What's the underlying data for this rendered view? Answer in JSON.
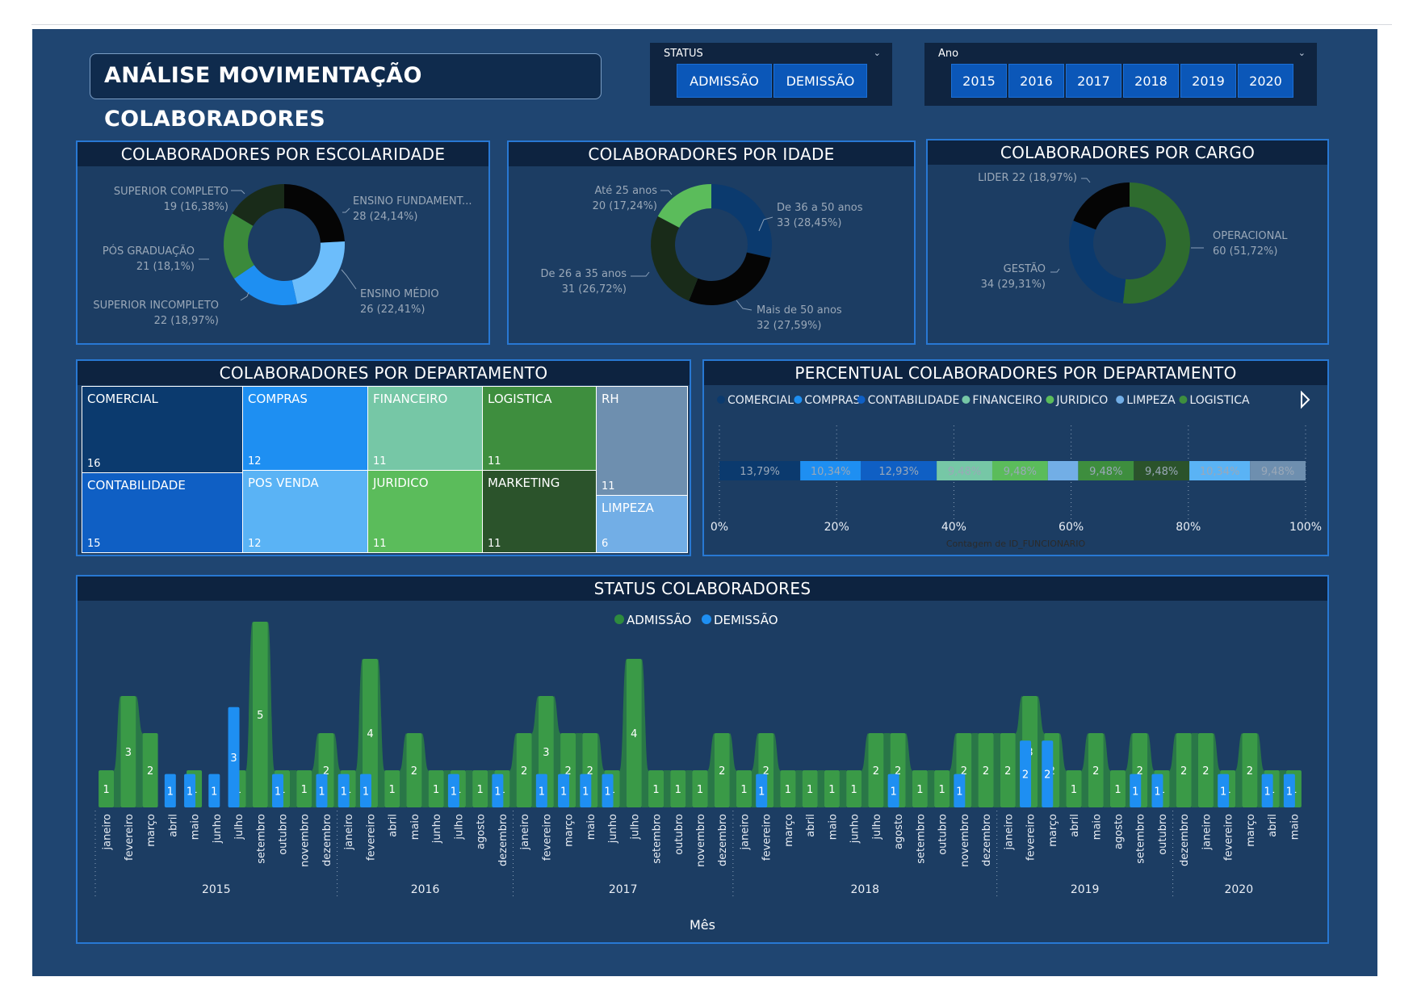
{
  "header": {
    "title": "ANÁLISE MOVIMENTAÇÃO COLABORADORES"
  },
  "status_slicer": {
    "label": "STATUS",
    "options": [
      "ADMISSÃO",
      "DEMISSÃO"
    ]
  },
  "year_slicer": {
    "label": "Ano",
    "options": [
      "2015",
      "2016",
      "2017",
      "2018",
      "2019",
      "2020"
    ]
  },
  "colors": {
    "dark_navy": "#0b3a6e",
    "blue": "#1e8ff2",
    "light_blue": "#6cbdfb",
    "green_dark": "#2e6b2e",
    "green": "#44a844",
    "green_light": "#5bbc5b",
    "black": "#050505",
    "very_dark_green": "#192b19"
  },
  "donut_escolaridade": {
    "title": "COLABORADORES POR ESCOLARIDADE",
    "slices": [
      {
        "label": "ENSINO FUNDAMENT...",
        "value": 28,
        "display": "28 (24,14%)",
        "color": "#050505"
      },
      {
        "label": "ENSINO MÉDIO",
        "value": 26,
        "display": "26 (22,41%)",
        "color": "#6cbdfb"
      },
      {
        "label": "SUPERIOR INCOMPLETO",
        "value": 22,
        "display": "22 (18,97%)",
        "color": "#1e8ff2"
      },
      {
        "label": "PÓS GRADUAÇÃO",
        "value": 21,
        "display": "21 (18,1%)",
        "color": "#3b8a3b"
      },
      {
        "label": "SUPERIOR COMPLETO",
        "value": 19,
        "display": "19 (16,38%)",
        "color": "#192b19"
      }
    ]
  },
  "donut_idade": {
    "title": "COLABORADORES POR IDADE",
    "slices": [
      {
        "label": "De 36 a 50 anos",
        "value": 33,
        "display": "33 (28,45%)",
        "color": "#0b3a6e"
      },
      {
        "label": "Mais de 50 anos",
        "value": 32,
        "display": "32 (27,59%)",
        "color": "#050505"
      },
      {
        "label": "De 26 a 35 anos",
        "value": 31,
        "display": "31 (26,72%)",
        "color": "#192b19"
      },
      {
        "label": "Até 25 anos",
        "value": 20,
        "display": "20 (17,24%)",
        "color": "#5bbc5b"
      }
    ]
  },
  "donut_cargo": {
    "title": "COLABORADORES POR CARGO",
    "slices": [
      {
        "label": "OPERACIONAL",
        "value": 60,
        "display": "60 (51,72%)",
        "color": "#2e6b2e"
      },
      {
        "label": "GESTÃO",
        "value": 34,
        "display": "34 (29,31%)",
        "color": "#0b3a6e"
      },
      {
        "label": "LIDER",
        "value": 22,
        "display": "LIDER 22 (18,97%)",
        "color": "#050505"
      }
    ]
  },
  "treemap": {
    "title": "COLABORADORES POR DEPARTAMENTO",
    "cells": [
      {
        "name": "COMERCIAL",
        "value": "16",
        "color": "#0b3a6e"
      },
      {
        "name": "CONTABILIDADE",
        "value": "15",
        "color": "#0f5fc4"
      },
      {
        "name": "COMPRAS",
        "value": "12",
        "color": "#1e8ff2"
      },
      {
        "name": "POS VENDA",
        "value": "12",
        "color": "#5ab3f5"
      },
      {
        "name": "FINANCEIRO",
        "value": "11",
        "color": "#76c7a6"
      },
      {
        "name": "JURIDICO",
        "value": "11",
        "color": "#5bbc5b"
      },
      {
        "name": "LOGISTICA",
        "value": "11",
        "color": "#3e8e3e"
      },
      {
        "name": "MARKETING",
        "value": "11",
        "color": "#2b532b"
      },
      {
        "name": "RH",
        "value": "11",
        "color": "#6e8faf"
      },
      {
        "name": "LIMPEZA",
        "value": "6",
        "color": "#72aee6"
      }
    ]
  },
  "percent_chart": {
    "title": "PERCENTUAL COLABORADORES POR DEPARTAMENTO",
    "legend": [
      {
        "name": "COMERCIAL",
        "color": "#0b3a6e"
      },
      {
        "name": "COMPRAS",
        "color": "#1e8ff2"
      },
      {
        "name": "CONTABILIDADE",
        "color": "#0f5fc4"
      },
      {
        "name": "FINANCEIRO",
        "color": "#76c7a6"
      },
      {
        "name": "JURIDICO",
        "color": "#5bbc5b"
      },
      {
        "name": "LIMPEZA",
        "color": "#72aee6"
      },
      {
        "name": "LOGISTICA",
        "color": "#3e8e3e"
      }
    ],
    "segments": [
      {
        "dept": "COMERCIAL",
        "pct": 13.79,
        "label": "13,79%",
        "color": "#0b3a6e"
      },
      {
        "dept": "COMPRAS",
        "pct": 10.34,
        "label": "10,34%",
        "color": "#1e8ff2"
      },
      {
        "dept": "CONTABILIDADE",
        "pct": 12.93,
        "label": "12,93%",
        "color": "#0f5fc4"
      },
      {
        "dept": "FINANCEIRO",
        "pct": 9.48,
        "label": "9,48%",
        "color": "#76c7a6"
      },
      {
        "dept": "JURIDICO",
        "pct": 9.48,
        "label": "9,48%",
        "color": "#5bbc5b"
      },
      {
        "dept": "LIMPEZA",
        "pct": 5.17,
        "label": "",
        "color": "#72aee6"
      },
      {
        "dept": "LOGISTICA",
        "pct": 9.48,
        "label": "9,48%",
        "color": "#3e8e3e"
      },
      {
        "dept": "MARKETING",
        "pct": 9.48,
        "label": "9,48%",
        "color": "#2b532b"
      },
      {
        "dept": "POS VENDA",
        "pct": 10.34,
        "label": "10,34%",
        "color": "#5ab3f5"
      },
      {
        "dept": "RH",
        "pct": 9.48,
        "label": "9,48%",
        "color": "#6e8faf"
      }
    ],
    "ticks": [
      "0%",
      "20%",
      "40%",
      "60%",
      "80%",
      "100%"
    ],
    "xlabel": "Contagem de ID_FUNCIONARIO"
  },
  "chart_data": {
    "type": "bar",
    "title": "STATUS COLABORADORES",
    "xlabel": "Mês",
    "legend": [
      {
        "name": "ADMISSÃO",
        "color": "#2e8b3e"
      },
      {
        "name": "DEMISSÃO",
        "color": "#1e8ff2"
      }
    ],
    "ylim": [
      0,
      5
    ],
    "groups": [
      {
        "year": "2015",
        "months": [
          {
            "m": "janeiro",
            "a": 1,
            "d": 0
          },
          {
            "m": "fevereiro",
            "a": 3,
            "d": 0
          },
          {
            "m": "março",
            "a": 2,
            "d": 0
          },
          {
            "m": "abril",
            "a": 0,
            "d": 1
          },
          {
            "m": "maio",
            "a": 1,
            "d": 1
          },
          {
            "m": "junho",
            "a": 0,
            "d": 1
          },
          {
            "m": "julho",
            "a": 1,
            "d": 3
          },
          {
            "m": "setembro",
            "a": 5,
            "d": 0
          },
          {
            "m": "outubro",
            "a": 1,
            "d": 1
          },
          {
            "m": "novembro",
            "a": 1,
            "d": 0
          },
          {
            "m": "dezembro",
            "a": 2,
            "d": 1
          }
        ]
      },
      {
        "year": "2016",
        "months": [
          {
            "m": "janeiro",
            "a": 1,
            "d": 1
          },
          {
            "m": "fevereiro",
            "a": 4,
            "d": 1
          },
          {
            "m": "abril",
            "a": 1,
            "d": 0
          },
          {
            "m": "maio",
            "a": 2,
            "d": 0
          },
          {
            "m": "junho",
            "a": 1,
            "d": 0
          },
          {
            "m": "julho",
            "a": 1,
            "d": 1
          },
          {
            "m": "agosto",
            "a": 1,
            "d": 0
          },
          {
            "m": "dezembro",
            "a": 1,
            "d": 1
          }
        ]
      },
      {
        "year": "2017",
        "months": [
          {
            "m": "janeiro",
            "a": 2,
            "d": 0
          },
          {
            "m": "fevereiro",
            "a": 3,
            "d": 1
          },
          {
            "m": "março",
            "a": 2,
            "d": 1
          },
          {
            "m": "maio",
            "a": 2,
            "d": 1
          },
          {
            "m": "junho",
            "a": 1,
            "d": 1
          },
          {
            "m": "julho",
            "a": 4,
            "d": 0
          },
          {
            "m": "setembro",
            "a": 1,
            "d": 0
          },
          {
            "m": "outubro",
            "a": 1,
            "d": 0
          },
          {
            "m": "novembro",
            "a": 1,
            "d": 0
          },
          {
            "m": "dezembro",
            "a": 2,
            "d": 0
          }
        ]
      },
      {
        "year": "2018",
        "months": [
          {
            "m": "janeiro",
            "a": 1,
            "d": 0
          },
          {
            "m": "fevereiro",
            "a": 2,
            "d": 1
          },
          {
            "m": "março",
            "a": 1,
            "d": 0
          },
          {
            "m": "abril",
            "a": 1,
            "d": 0
          },
          {
            "m": "maio",
            "a": 1,
            "d": 0
          },
          {
            "m": "junho",
            "a": 1,
            "d": 0
          },
          {
            "m": "julho",
            "a": 2,
            "d": 0
          },
          {
            "m": "agosto",
            "a": 2,
            "d": 1
          },
          {
            "m": "setembro",
            "a": 1,
            "d": 0
          },
          {
            "m": "outubro",
            "a": 1,
            "d": 0
          },
          {
            "m": "novembro",
            "a": 2,
            "d": 1
          },
          {
            "m": "dezembro",
            "a": 2,
            "d": 0
          }
        ]
      },
      {
        "year": "2019",
        "months": [
          {
            "m": "janeiro",
            "a": 2,
            "d": 0
          },
          {
            "m": "fevereiro",
            "a": 3,
            "d": 2
          },
          {
            "m": "março",
            "a": 2,
            "d": 2
          },
          {
            "m": "abril",
            "a": 1,
            "d": 0
          },
          {
            "m": "maio",
            "a": 2,
            "d": 0
          },
          {
            "m": "agosto",
            "a": 1,
            "d": 0
          },
          {
            "m": "setembro",
            "a": 2,
            "d": 1
          },
          {
            "m": "outubro",
            "a": 1,
            "d": 1
          }
        ]
      },
      {
        "year": "2020",
        "months": [
          {
            "m": "dezembro",
            "a": 2,
            "d": 0
          },
          {
            "m": "janeiro",
            "a": 2,
            "d": 0
          },
          {
            "m": "fevereiro",
            "a": 1,
            "d": 1
          },
          {
            "m": "março",
            "a": 2,
            "d": 0
          },
          {
            "m": "abril",
            "a": 1,
            "d": 1
          },
          {
            "m": "maio",
            "a": 1,
            "d": 1
          }
        ]
      }
    ]
  }
}
